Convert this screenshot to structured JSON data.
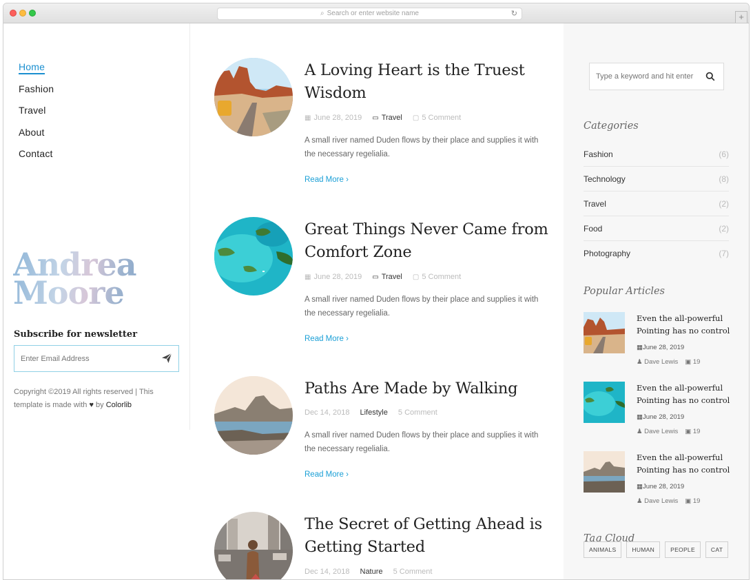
{
  "browser": {
    "url_placeholder": "Search or enter website name",
    "new_tab": "+"
  },
  "nav": {
    "items": [
      {
        "label": "Home",
        "active": true
      },
      {
        "label": "Fashion",
        "active": false
      },
      {
        "label": "Travel",
        "active": false
      },
      {
        "label": "About",
        "active": false
      },
      {
        "label": "Contact",
        "active": false
      }
    ]
  },
  "brand": {
    "line1": "Andrea",
    "line2": "Moore"
  },
  "newsletter": {
    "title": "Subscribe for newsletter",
    "email_placeholder": "Enter Email Address",
    "copyright_prefix": "Copyright ©2019 All rights reserved | This template is made with",
    "heart": "♥",
    "by": "by",
    "brand": "Colorlib"
  },
  "posts": [
    {
      "title": "A Loving Heart is the Truest Wisdom",
      "date": "June 28, 2019",
      "category": "Travel",
      "comments": "5 Comment",
      "excerpt": "A small river named Duden flows by their place and supplies it with the necessary regelialia.",
      "read_more": "Read More"
    },
    {
      "title": "Great Things Never Came from Comfort Zone",
      "date": "June 28, 2019",
      "category": "Travel",
      "comments": "5 Comment",
      "excerpt": "A small river named Duden flows by their place and supplies it with the necessary regelialia.",
      "read_more": "Read More"
    },
    {
      "title": "Paths Are Made by Walking",
      "date": "Dec 14, 2018",
      "category": "Lifestyle",
      "comments": "5 Comment",
      "excerpt": "A small river named Duden flows by their place and supplies it with the necessary regelialia.",
      "read_more": "Read More"
    },
    {
      "title": "The Secret of Getting Ahead is Getting Started",
      "date": "Dec 14, 2018",
      "category": "Nature",
      "comments": "5 Comment"
    }
  ],
  "sidebar": {
    "search_placeholder": "Type a keyword and hit enter",
    "categories_title": "Categories",
    "categories": [
      {
        "name": "Fashion",
        "count": "(6)"
      },
      {
        "name": "Technology",
        "count": "(8)"
      },
      {
        "name": "Travel",
        "count": "(2)"
      },
      {
        "name": "Food",
        "count": "(2)"
      },
      {
        "name": "Photography",
        "count": "(7)"
      }
    ],
    "popular_title": "Popular Articles",
    "popular": [
      {
        "title": "Even the all-powerful Pointing has no control",
        "date": "June 28, 2019",
        "author": "Dave Lewis",
        "comments": "19"
      },
      {
        "title": "Even the all-powerful Pointing has no control",
        "date": "June 28, 2019",
        "author": "Dave Lewis",
        "comments": "19"
      },
      {
        "title": "Even the all-powerful Pointing has no control",
        "date": "June 28, 2019",
        "author": "Dave Lewis",
        "comments": "19"
      }
    ],
    "tag_cloud_title": "Tag Cloud",
    "tags": [
      "ANIMALS",
      "HUMAN",
      "PEOPLE",
      "CAT"
    ]
  },
  "colors": {
    "accent": "#1a8fd0",
    "link": "#1a9fd6",
    "sidebar_bg": "#f7f7f7"
  }
}
